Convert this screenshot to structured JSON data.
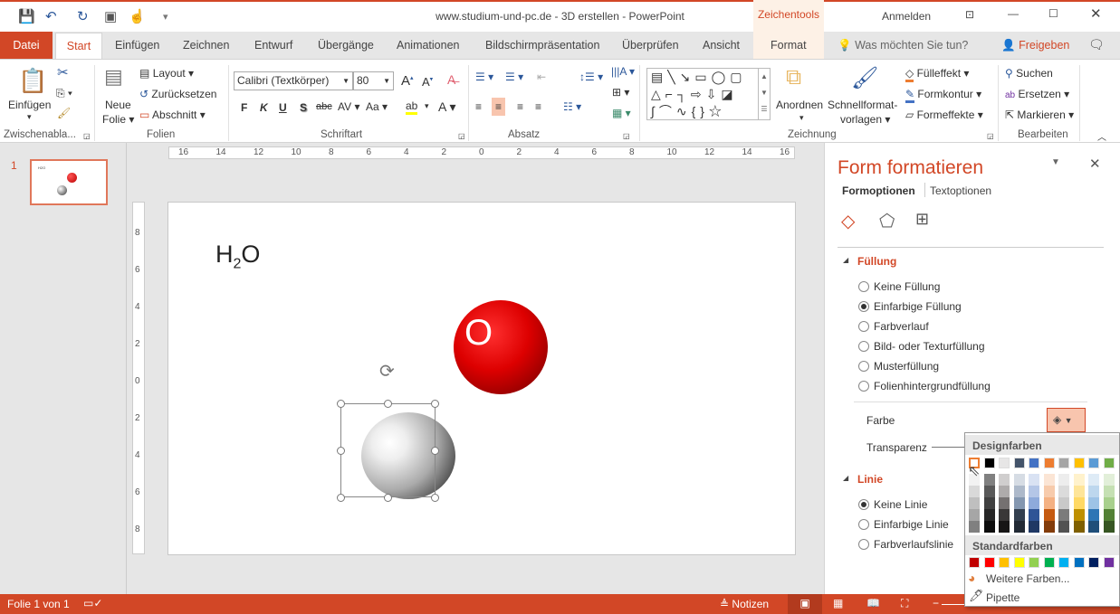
{
  "title": "www.studium-und-pc.de - 3D erstellen  -  PowerPoint",
  "context_tab": "Zeichentools",
  "account": "Anmelden",
  "tabs": [
    "Datei",
    "Start",
    "Einfügen",
    "Zeichnen",
    "Entwurf",
    "Übergänge",
    "Animationen",
    "Bildschirmpräsentation",
    "Überprüfen",
    "Ansicht",
    "Format"
  ],
  "tell_me": "Was möchten Sie tun?",
  "share": "Freigeben",
  "ribbon": {
    "clipboard": {
      "paste": "Einfügen",
      "group": "Zwischenabla..."
    },
    "slides": {
      "new1": "Neue",
      "new2": "Folie",
      "layout": "Layout",
      "reset": "Zurücksetzen",
      "section": "Abschnitt",
      "group": "Folien"
    },
    "font": {
      "name": "Calibri (Textkörper)",
      "size": "80",
      "bold": "F",
      "italic": "K",
      "underline": "U",
      "shadow": "S",
      "strike": "abc",
      "spacing": "AV",
      "case": "Aa",
      "group": "Schriftart"
    },
    "paragraph": {
      "group": "Absatz"
    },
    "drawing": {
      "arrange": "Anordnen",
      "quick1": "Schnellformat-",
      "quick2": "vorlagen",
      "fill": "Fülleffekt",
      "outline": "Formkontur",
      "effects": "Formeffekte",
      "group": "Zeichnung"
    },
    "editing": {
      "find": "Suchen",
      "replace": "Ersetzen",
      "select": "Markieren",
      "group": "Bearbeiten"
    }
  },
  "thumbnail_number": "1",
  "ruler_h": [
    "16",
    "14",
    "12",
    "10",
    "8",
    "6",
    "4",
    "2",
    "0",
    "2",
    "4",
    "6",
    "8",
    "10",
    "12",
    "14",
    "16"
  ],
  "ruler_v": [
    "8",
    "6",
    "4",
    "2",
    "0",
    "2",
    "4",
    "6",
    "8"
  ],
  "slide": {
    "formula_main": "H",
    "formula_sub": "2",
    "formula_end": "O",
    "oxygen_label": "O"
  },
  "pane": {
    "title": "Form formatieren",
    "tab_shape": "Formoptionen",
    "tab_text": "Textoptionen",
    "fill_section": "Füllung",
    "fill_options": [
      {
        "label": "Keine Füllung",
        "selected": false
      },
      {
        "label": "Einfarbige Füllung",
        "selected": true
      },
      {
        "label": "Farbverlauf",
        "selected": false
      },
      {
        "label": "Bild- oder Texturfüllung",
        "selected": false
      },
      {
        "label": "Musterfüllung",
        "selected": false
      },
      {
        "label": "Folienhintergrundfüllung",
        "selected": false
      }
    ],
    "color_label": "Farbe",
    "transparency_label": "Transparenz",
    "line_section": "Linie",
    "line_options": [
      {
        "label": "Keine Linie",
        "selected": true
      },
      {
        "label": "Einfarbige Linie",
        "selected": false
      },
      {
        "label": "Farbverlaufslinie",
        "selected": false
      }
    ]
  },
  "color_popup": {
    "design_header": "Designfarben",
    "design_colors": [
      "#FFFFFF",
      "#000000",
      "#E7E6E6",
      "#44546A",
      "#4472C4",
      "#ED7D31",
      "#A5A5A5",
      "#FFC000",
      "#5B9BD5",
      "#70AD47"
    ],
    "shades": [
      [
        "#F2F2F2",
        "#D9D9D9",
        "#BFBFBF",
        "#A6A6A6",
        "#808080"
      ],
      [
        "#808080",
        "#595959",
        "#404040",
        "#262626",
        "#0D0D0D"
      ],
      [
        "#D0CECE",
        "#AEABAB",
        "#757171",
        "#3A3838",
        "#171616"
      ],
      [
        "#D6DCE4",
        "#ADB9CA",
        "#8497B0",
        "#333F4F",
        "#222A35"
      ],
      [
        "#D9E2F3",
        "#B4C6E7",
        "#8EAADB",
        "#2F5496",
        "#1F3864"
      ],
      [
        "#FBE5D5",
        "#F7CBAC",
        "#F4B183",
        "#C55A11",
        "#833C0B"
      ],
      [
        "#EDEDED",
        "#DBDBDB",
        "#C9C9C9",
        "#7B7B7B",
        "#525252"
      ],
      [
        "#FFF2CC",
        "#FEE599",
        "#FFD965",
        "#BF9000",
        "#7F6000"
      ],
      [
        "#DEEBF6",
        "#BDD7EE",
        "#9DC3E6",
        "#2E75B5",
        "#1F4E79"
      ],
      [
        "#E2EFD9",
        "#C5E0B3",
        "#A8D08D",
        "#538135",
        "#375623"
      ]
    ],
    "standard_header": "Standardfarben",
    "standard_colors": [
      "#C00000",
      "#FF0000",
      "#FFC000",
      "#FFFF00",
      "#92D050",
      "#00B050",
      "#00B0F0",
      "#0070C0",
      "#002060",
      "#7030A0"
    ],
    "more_colors": "Weitere Farben...",
    "eyedropper": "Pipette"
  },
  "status": {
    "slide": "Folie 1 von 1",
    "notes": "Notizen"
  },
  "accent": "#D24726"
}
